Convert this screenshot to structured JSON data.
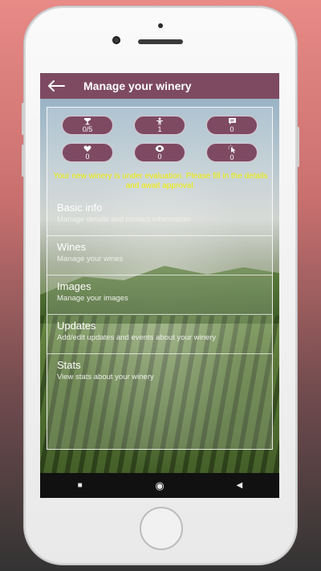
{
  "app_bar": {
    "title": "Manage your winery"
  },
  "stats": [
    {
      "icon": "wine-glass-icon",
      "value": "0/5"
    },
    {
      "icon": "person-icon",
      "value": "1"
    },
    {
      "icon": "message-icon",
      "value": "0"
    },
    {
      "icon": "heart-icon",
      "value": "0"
    },
    {
      "icon": "eye-icon",
      "value": "0"
    },
    {
      "icon": "pointer-click-icon",
      "value": "0"
    }
  ],
  "notice": "Your new winery is under evaluation. Please fill in the details and await approval.",
  "menu": [
    {
      "title": "Basic info",
      "subtitle": "Manage details and contact information"
    },
    {
      "title": "Wines",
      "subtitle": "Manage your wines"
    },
    {
      "title": "Images",
      "subtitle": "Manage your images"
    },
    {
      "title": "Updates",
      "subtitle": "Add/edit updates and events about your winery"
    },
    {
      "title": "Stats",
      "subtitle": "View stats about your winery"
    }
  ],
  "nav_bar": {
    "recent": "■",
    "home": "◉",
    "back": "◀"
  },
  "colors": {
    "app_bar": "#7d4a62",
    "notice": "#f4f000"
  }
}
